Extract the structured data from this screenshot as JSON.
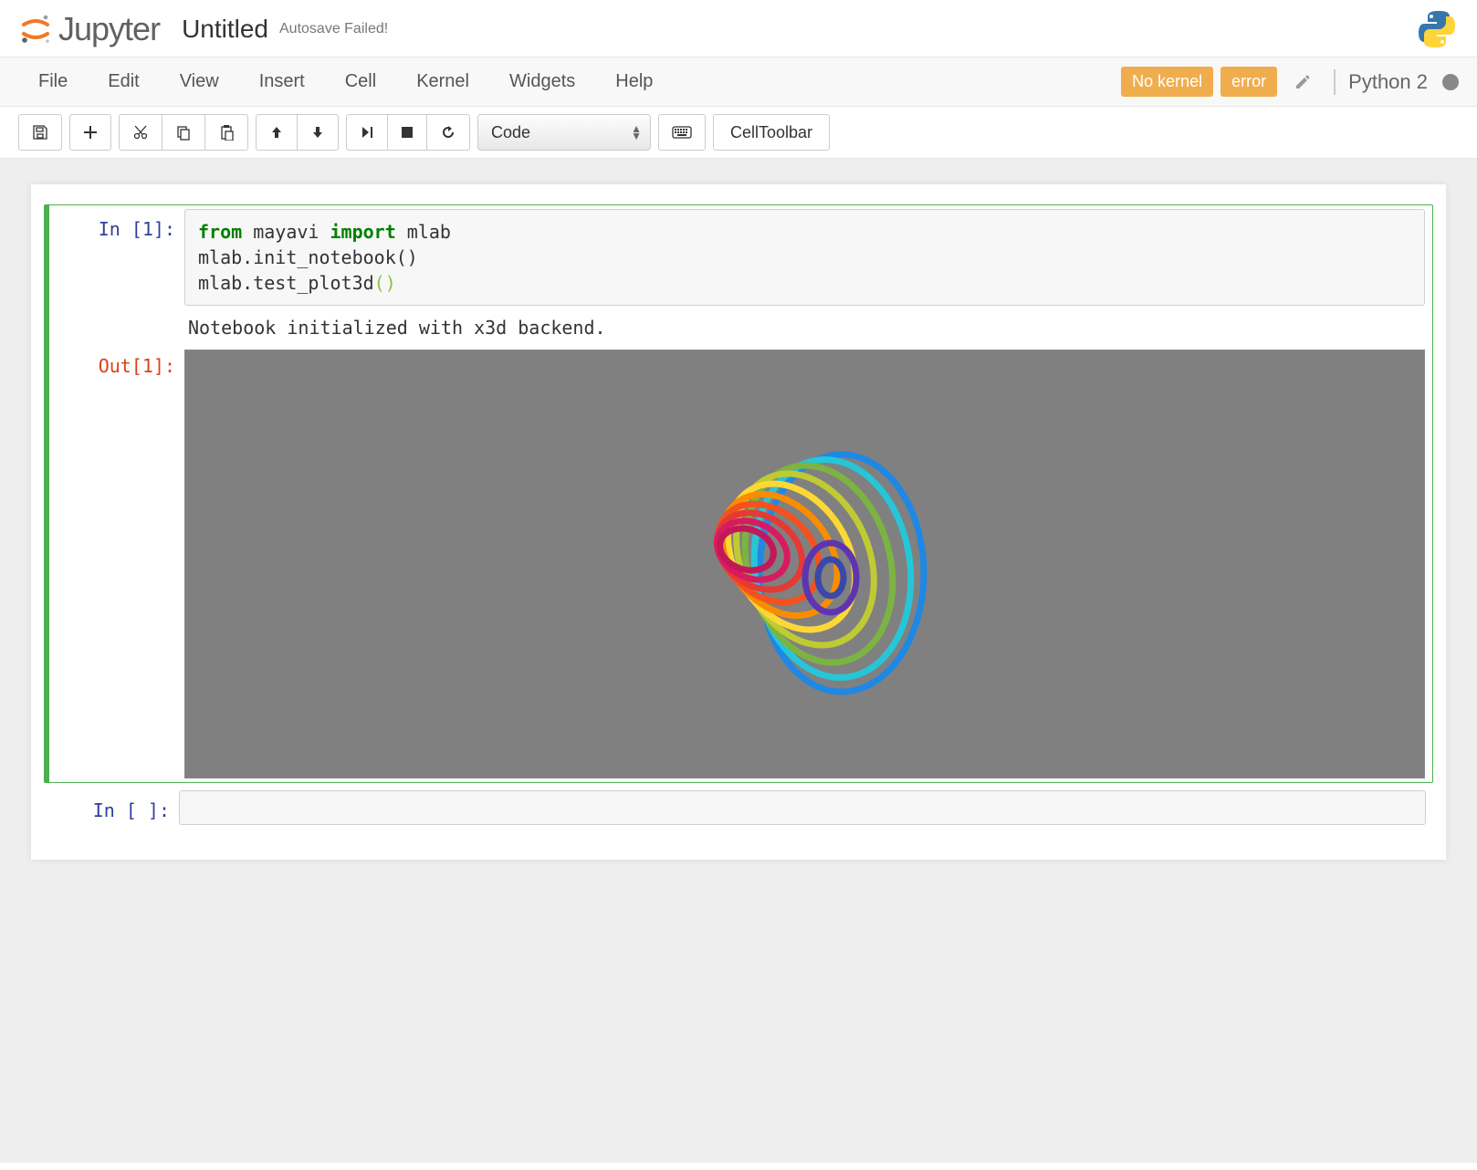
{
  "header": {
    "logo_text": "Jupyter",
    "notebook_name": "Untitled",
    "autosave_status": "Autosave Failed!"
  },
  "menubar": {
    "items": [
      "File",
      "Edit",
      "View",
      "Insert",
      "Cell",
      "Kernel",
      "Widgets",
      "Help"
    ],
    "badges": {
      "no_kernel": "No kernel",
      "error": "error"
    },
    "kernel_name": "Python 2"
  },
  "toolbar": {
    "cell_type_selected": "Code",
    "cell_toolbar_label": "CellToolbar"
  },
  "cells": [
    {
      "in_prompt": "In [1]:",
      "out_prompt": "Out[1]:",
      "code_tokens": [
        {
          "t": "from",
          "c": "kw-green"
        },
        {
          "t": " mayavi "
        },
        {
          "t": "import",
          "c": "kw-green"
        },
        {
          "t": " mlab\n"
        },
        {
          "t": "mlab.init_notebook()\n"
        },
        {
          "t": "mlab.test_plot3d"
        },
        {
          "t": "()",
          "c": "paren-light"
        }
      ],
      "stdout": "Notebook initialized with x3d backend."
    },
    {
      "in_prompt": "In [ ]:"
    }
  ]
}
